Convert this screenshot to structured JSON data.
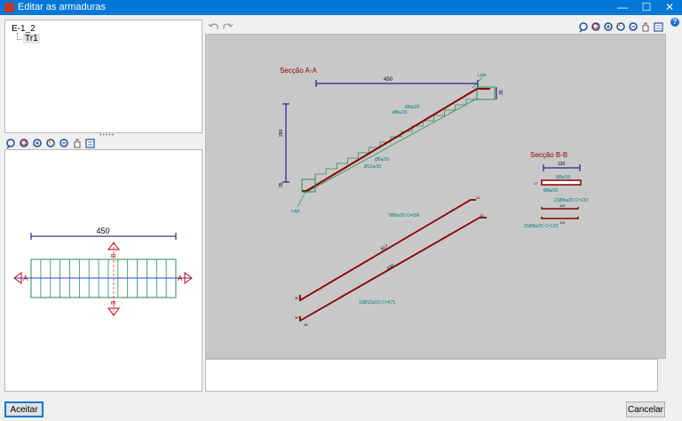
{
  "window": {
    "title": "Editar as armaduras",
    "minimize": "—",
    "maximize": "☐",
    "close": "✕"
  },
  "tree": {
    "root": "E-1_2",
    "child": "Tr1"
  },
  "plan": {
    "width_label": "450",
    "section_a": "A",
    "section_b": "B"
  },
  "drawing": {
    "section_aa": {
      "title": "Secção A-A",
      "length_label": "450",
      "landing_top_label": "Laje",
      "landing_bottom_label": "Laje",
      "height_label": "280",
      "top_thickness": "35",
      "bottom_thickness": "35",
      "rebar_labels": [
        "Ø8a/20",
        "Ø8a/20",
        "Ø8a/20",
        "Ø12a/10"
      ]
    },
    "section_bb": {
      "title": "Secção B-B",
      "width_label": "120",
      "thickness": "17",
      "top_label": "Ø8a/20",
      "bottom_label": "Ø8a/20",
      "bar1_label": "21Ø8a/20 C=133",
      "bar2_label": "21Ø8a/20 C=133",
      "bar_length": "119"
    },
    "bars": {
      "top_bar_label": "7Ø8a/20 C=656",
      "bottom_bar_label": "13Ø12a/10 C=675",
      "top_bar_len": "617",
      "bottom_bar_len": "630",
      "end_a": "12",
      "end_b": "12",
      "end_c": "16",
      "end_d": "30",
      "end_e": "30"
    }
  },
  "buttons": {
    "accept": "Aceitar",
    "cancel": "Cancelar"
  },
  "colors": {
    "accent": "#0078d7",
    "rebar": "#8b0000",
    "dim": "#000080",
    "label": "#008080",
    "concrete": "#2e8b57"
  }
}
